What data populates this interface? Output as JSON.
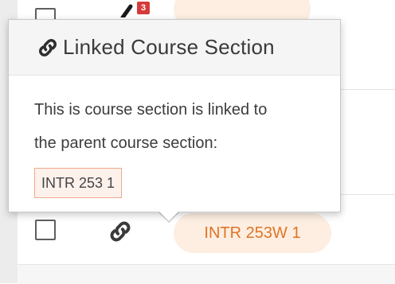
{
  "top_row": {
    "badge_count": "3",
    "pill_label": ""
  },
  "popover": {
    "icon": "link-icon",
    "title": "Linked Course Section",
    "line1": "This is course section is linked to",
    "line2": "the parent course section:",
    "parent_section": "INTR 253 1"
  },
  "bottom_row": {
    "icon": "link-icon",
    "pill_label": "INTR 253W 1"
  },
  "colors": {
    "pill_bg": "#fdeee1",
    "pill_text": "#e07426",
    "badge_red": "#d63b3b",
    "chip_border": "#f0a98a"
  }
}
